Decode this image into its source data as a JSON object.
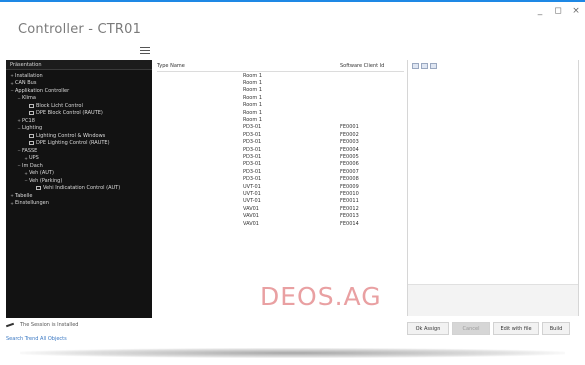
{
  "window": {
    "title": "Controller - CTR01",
    "controls": [
      "_",
      "◻",
      "×"
    ]
  },
  "tree": {
    "header": "Präsentation",
    "items": [
      {
        "level": 0,
        "label": "Installation",
        "expander": "+"
      },
      {
        "level": 0,
        "label": "CAN Bus",
        "expander": "+"
      },
      {
        "level": 0,
        "label": "Applikation Controller",
        "expander": "−"
      },
      {
        "level": 1,
        "label": "Klima",
        "expander": "−"
      },
      {
        "level": 2,
        "label": "Block Licht Control",
        "icon": true
      },
      {
        "level": 2,
        "label": "DPE Block Control (RAUTE)",
        "icon": true
      },
      {
        "level": 1,
        "label": "PC18",
        "expander": "+"
      },
      {
        "level": 1,
        "label": "Lighting",
        "expander": "−"
      },
      {
        "level": 2,
        "label": "Lighting Control & Windows",
        "icon": true
      },
      {
        "level": 2,
        "label": "DPE Lighting Control (RAUTE)",
        "icon": true
      },
      {
        "level": 1,
        "label": "FASSE",
        "expander": "−"
      },
      {
        "level": 2,
        "label": "UPS",
        "expander": "+"
      },
      {
        "level": 1,
        "label": "Im Dach",
        "expander": "−"
      },
      {
        "level": 2,
        "label": "Veh (AUT)",
        "expander": "+"
      },
      {
        "level": 2,
        "label": "Veh (Parking)",
        "expander": "−"
      },
      {
        "level": 3,
        "label": "Vehi Indicatation Control (AUT)",
        "icon": true
      },
      {
        "level": 0,
        "label": "Tabelle",
        "expander": "+"
      },
      {
        "level": 0,
        "label": "Einstellungen",
        "expander": "+"
      }
    ]
  },
  "grid": {
    "columns": [
      "Type Name",
      "Software Client Id"
    ],
    "rows": [
      [
        "Room 1",
        ""
      ],
      [
        "Room 1",
        ""
      ],
      [
        "Room 1",
        ""
      ],
      [
        "Room 1",
        ""
      ],
      [
        "Room 1",
        ""
      ],
      [
        "Room 1",
        ""
      ],
      [
        "Room 1",
        ""
      ],
      [
        "PD3-01",
        "FE0001"
      ],
      [
        "PD3-01",
        "FE0002"
      ],
      [
        "PD3-01",
        "FE0003"
      ],
      [
        "PD3-01",
        "FE0004"
      ],
      [
        "PD3-01",
        "FE0005"
      ],
      [
        "PD3-01",
        "FE0006"
      ],
      [
        "PD3-01",
        "FE0007"
      ],
      [
        "PD3-01",
        "FE0008"
      ],
      [
        "UVT-01",
        "FE0009"
      ],
      [
        "UVT-01",
        "FE0010"
      ],
      [
        "UVT-01",
        "FE0011"
      ],
      [
        "VAV01",
        "FE0012"
      ],
      [
        "VAV01",
        "FE0013"
      ],
      [
        "VAV01",
        "FE0014"
      ]
    ]
  },
  "logo": "DEOS.AG",
  "status": {
    "text": "The Session is Installed",
    "link": "Search Trend All Objects"
  },
  "buttons": [
    {
      "label": "Ok Assign",
      "disabled": false
    },
    {
      "label": "Cancel",
      "disabled": true
    },
    {
      "label": "Edit with file",
      "disabled": false
    },
    {
      "label": "Build",
      "disabled": false
    }
  ]
}
